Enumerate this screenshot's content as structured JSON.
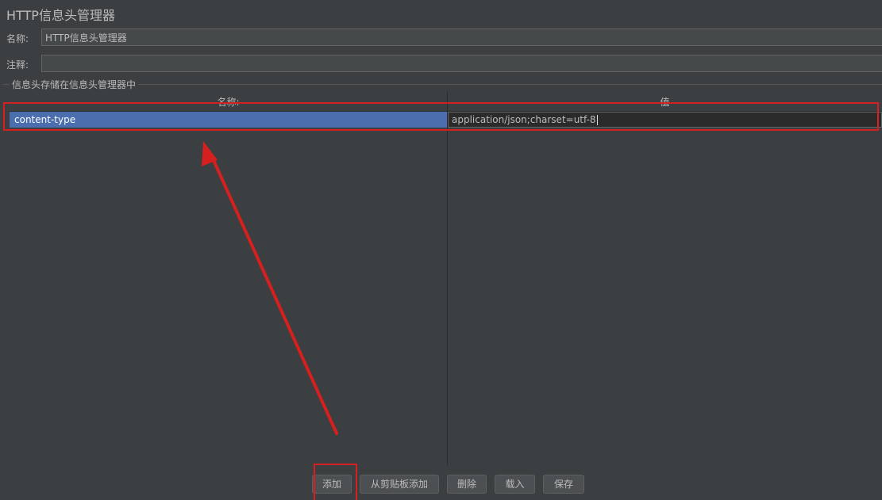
{
  "window": {
    "title": "HTTP信息头管理器"
  },
  "form": {
    "name_label": "名称:",
    "name_value": "HTTP信息头管理器",
    "comment_label": "注释:",
    "comment_value": ""
  },
  "group": {
    "label": "信息头存储在信息头管理器中"
  },
  "table": {
    "columns": [
      "名称:",
      "值"
    ],
    "rows": [
      {
        "name": "content-type",
        "value": "application/json;charset=utf-8"
      }
    ]
  },
  "buttons": {
    "add": "添加",
    "add_from_clipboard": "从剪贴板添加",
    "delete": "删除",
    "load": "载入",
    "save": "保存"
  },
  "colors": {
    "background": "#3c3f41",
    "selection": "#4b6eaf",
    "annotation": "#d61f1f"
  }
}
